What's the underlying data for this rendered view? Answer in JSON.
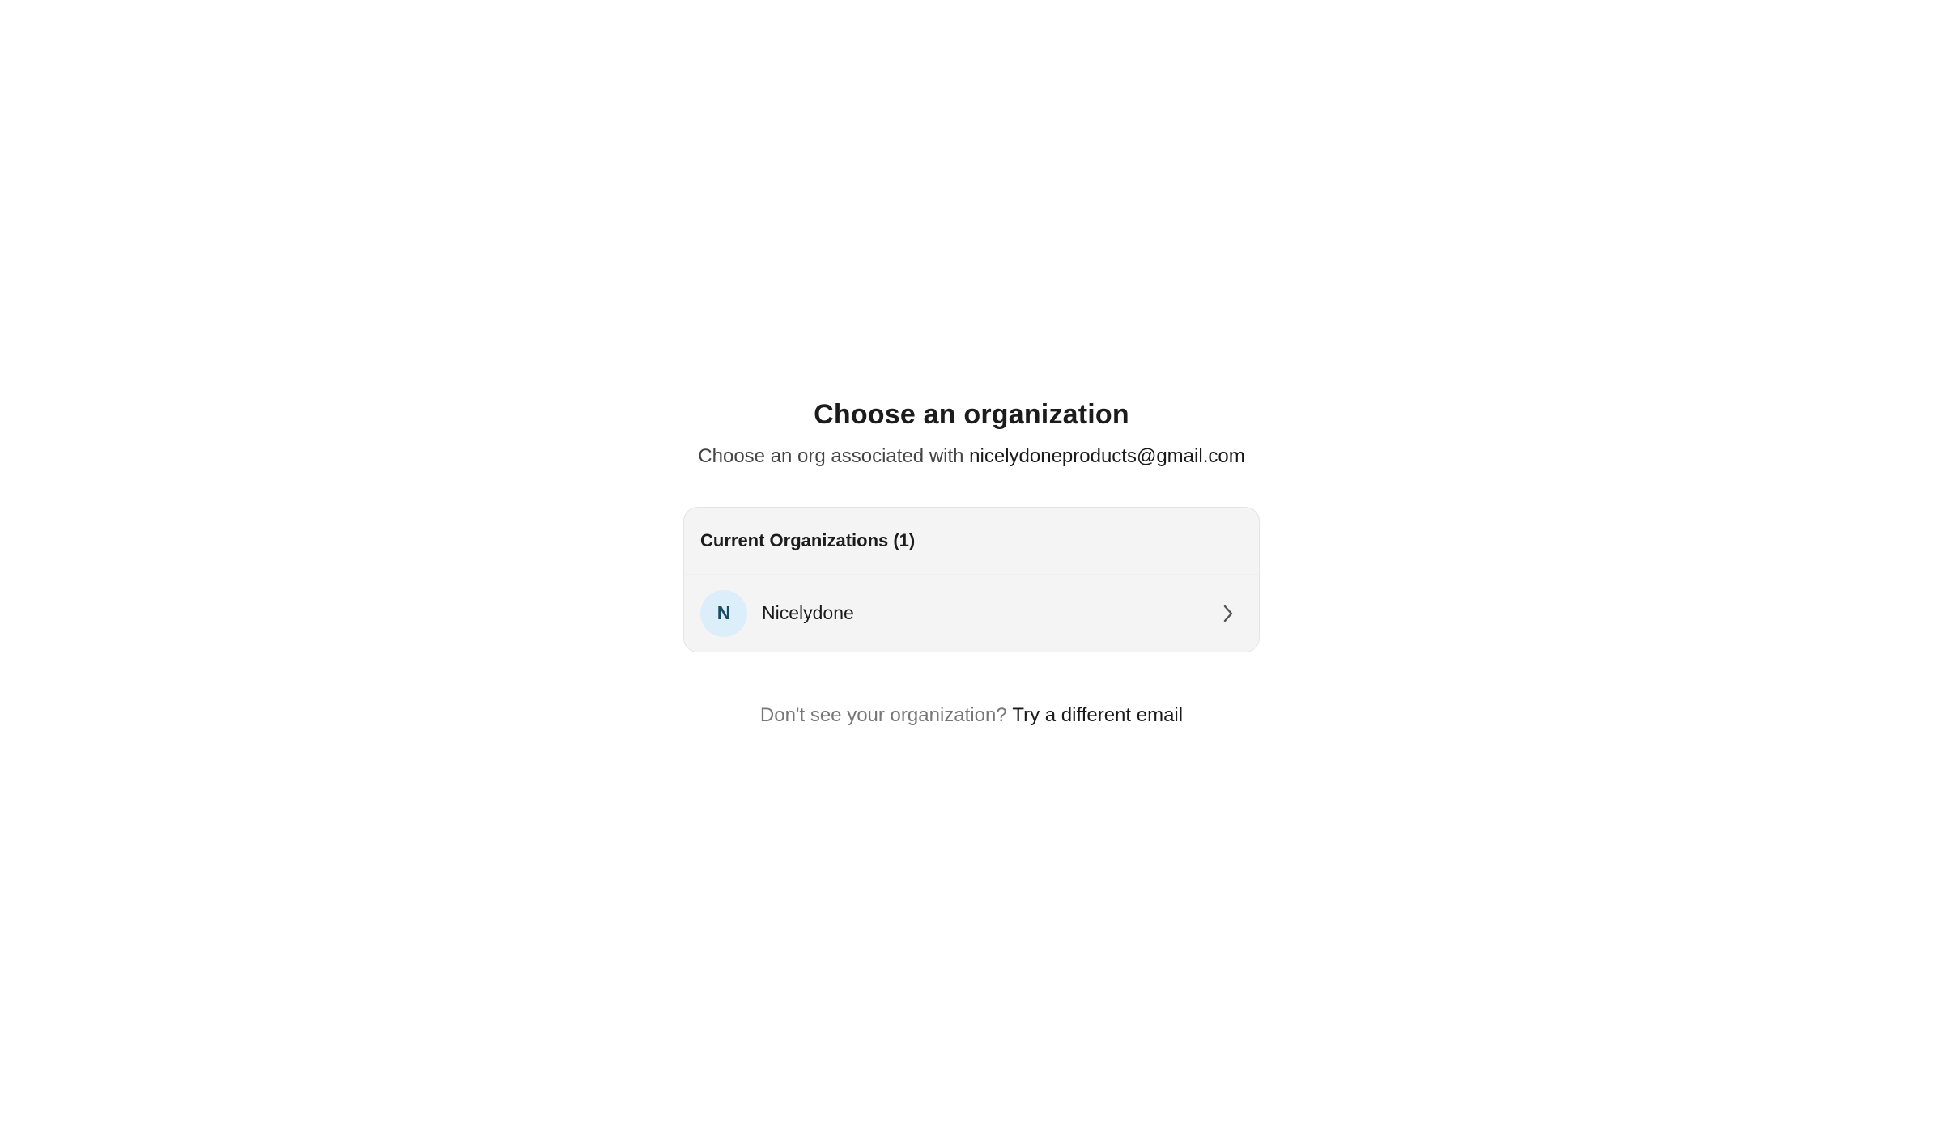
{
  "header": {
    "title": "Choose an organization",
    "subtitle_prefix": "Choose an org associated with",
    "email": "nicelydoneproducts@gmail.com"
  },
  "organizations": {
    "section_title": "Current Organizations (1)",
    "items": [
      {
        "initial": "N",
        "name": "Nicelydone",
        "avatar_bg": "#dbeefa",
        "avatar_fg": "#1b4a63",
        "icon": "chevron-right-icon"
      }
    ]
  },
  "footer": {
    "prompt": "Don't see your organization?",
    "link_label": "Try a different email"
  }
}
